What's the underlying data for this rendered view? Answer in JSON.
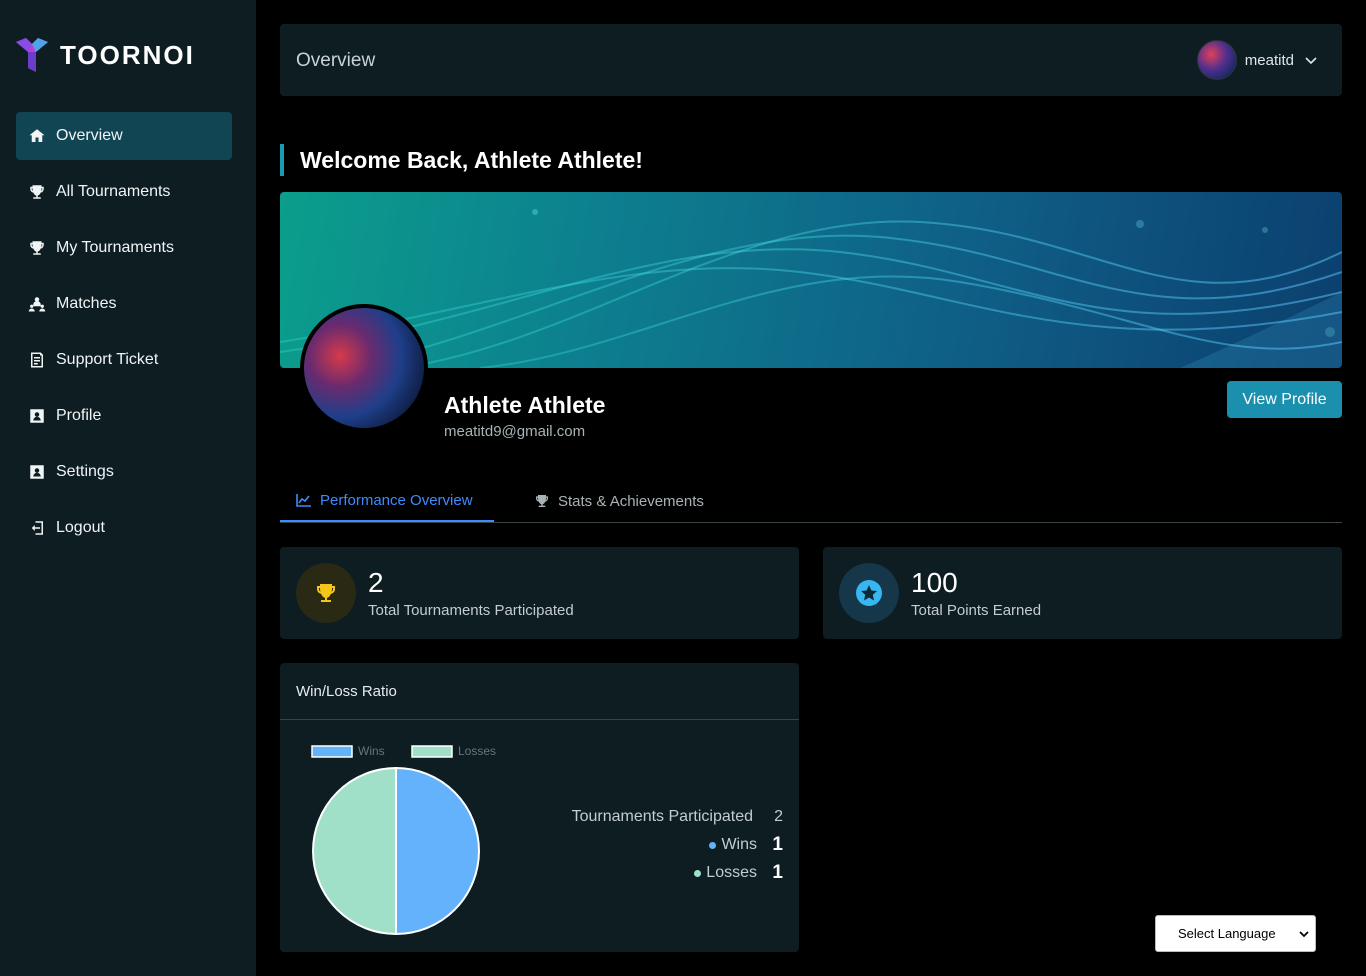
{
  "brand": {
    "name": "TOORNOI"
  },
  "sidebar": {
    "items": [
      {
        "label": "Overview",
        "icon": "home-icon",
        "active": true
      },
      {
        "label": "All Tournaments",
        "icon": "trophy-icon"
      },
      {
        "label": "My Tournaments",
        "icon": "trophy-icon"
      },
      {
        "label": "Matches",
        "icon": "players-icon"
      },
      {
        "label": "Support Ticket",
        "icon": "ticket-icon"
      },
      {
        "label": "Profile",
        "icon": "profile-icon"
      },
      {
        "label": "Settings",
        "icon": "profile-icon"
      },
      {
        "label": "Logout",
        "icon": "logout-icon"
      }
    ]
  },
  "header": {
    "title": "Overview",
    "username": "meatitd"
  },
  "welcome": {
    "text": "Welcome Back, Athlete Athlete!"
  },
  "profile": {
    "name": "Athlete Athlete",
    "email": "meatitd9@gmail.com",
    "view_profile_label": "View Profile"
  },
  "tabs": [
    {
      "label": "Performance Overview",
      "icon": "chart-line-icon",
      "active": true
    },
    {
      "label": "Stats & Achievements",
      "icon": "trophy-icon",
      "active": false
    }
  ],
  "stats": [
    {
      "value": "2",
      "label": "Total Tournaments Participated",
      "icon": "trophy-icon",
      "color": "#f5c518"
    },
    {
      "value": "100",
      "label": "Total Points Earned",
      "icon": "star-badge-icon",
      "color": "#38b6f0"
    }
  ],
  "winloss": {
    "title": "Win/Loss Ratio",
    "summary": {
      "participated_label": "Tournaments Participated",
      "participated_value": "2",
      "wins_label": "Wins",
      "wins_value": "1",
      "losses_label": "Losses",
      "losses_value": "1"
    }
  },
  "chart_data": {
    "type": "pie",
    "categories": [
      "Wins",
      "Losses"
    ],
    "values": [
      1,
      1
    ],
    "colors": [
      "#64b1fc",
      "#a1e0c8"
    ],
    "legend": "top-left"
  },
  "language_select": {
    "label": "Select Language"
  }
}
